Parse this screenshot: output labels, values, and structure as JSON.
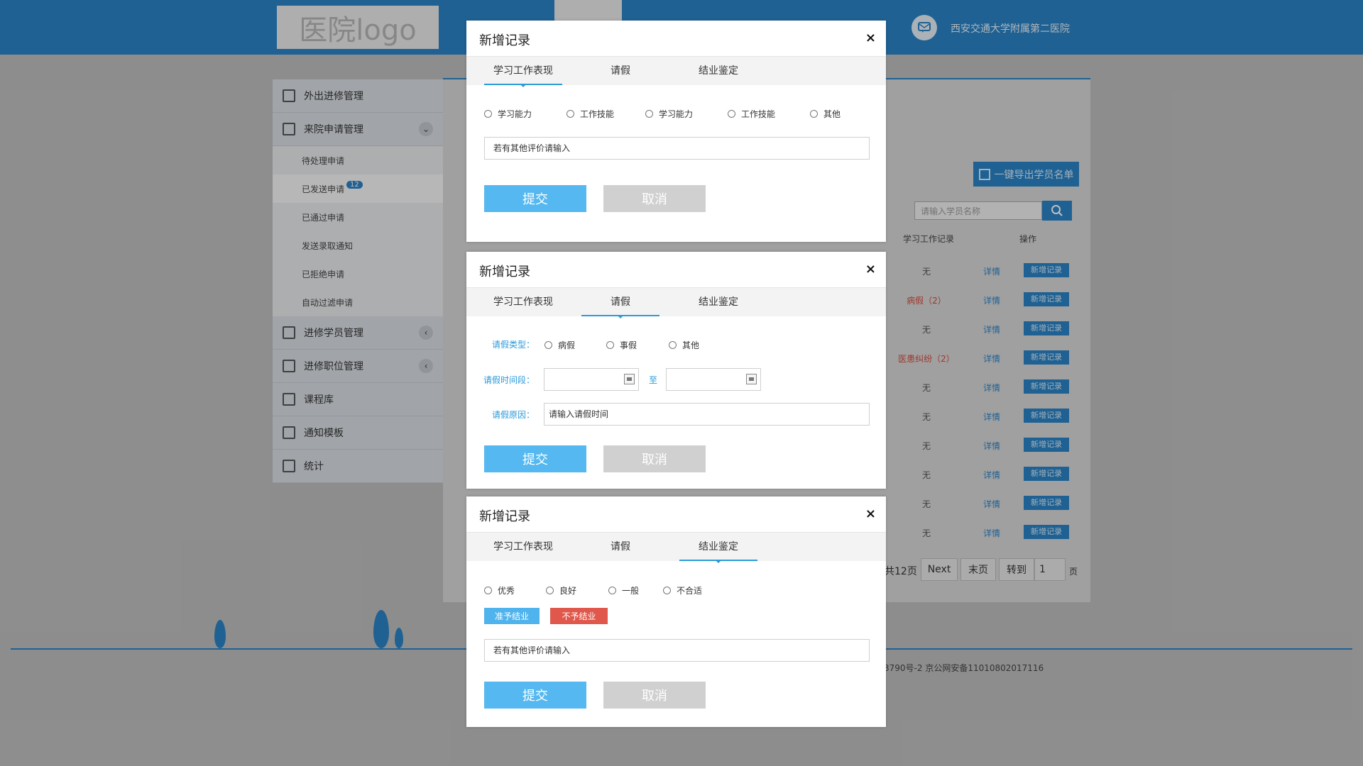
{
  "app": {
    "logo_text": "医院logo",
    "hospital_name": "西安交通大学附属第二医院"
  },
  "sidebar": {
    "items": [
      {
        "label": "外出进修管理",
        "icon": "clipboard-icon"
      },
      {
        "label": "来院申请管理",
        "icon": "form-icon",
        "expanded": true
      },
      {
        "label": "进修学员管理",
        "icon": "student-icon"
      },
      {
        "label": "进修职位管理",
        "icon": "position-icon"
      },
      {
        "label": "课程库",
        "icon": "course-icon"
      },
      {
        "label": "通知模板",
        "icon": "template-icon"
      },
      {
        "label": "统计",
        "icon": "bar-chart-icon"
      }
    ],
    "sub_items": [
      {
        "label": "待处理申请"
      },
      {
        "label": "已发送申请",
        "badge": "12"
      },
      {
        "label": "已通过申请"
      },
      {
        "label": "发送录取通知"
      },
      {
        "label": "已拒绝申请"
      },
      {
        "label": "自动过滤申请"
      }
    ]
  },
  "main": {
    "export_button": "一键导出学员名单",
    "search_placeholder": "请输入学员名称",
    "columns": [
      "学习工作记录",
      "操作"
    ],
    "rows": [
      {
        "record": "无",
        "detail": "详情",
        "add": "新增记录"
      },
      {
        "record": "病假（2）",
        "detail": "详情",
        "add": "新增记录"
      },
      {
        "record": "无",
        "detail": "详情",
        "add": "新增记录"
      },
      {
        "record": "医患纠纷（2）",
        "detail": "详情",
        "add": "新增记录"
      },
      {
        "record": "无",
        "detail": "详情",
        "add": "新增记录"
      },
      {
        "record": "无",
        "detail": "详情",
        "add": "新增记录"
      },
      {
        "record": "无",
        "detail": "详情",
        "add": "新增记录"
      },
      {
        "record": "无",
        "detail": "详情",
        "add": "新增记录"
      },
      {
        "record": "无",
        "detail": "详情",
        "add": "新增记录"
      },
      {
        "record": "无",
        "detail": "详情",
        "add": "新增记录"
      }
    ],
    "pager": {
      "total": "共12页",
      "next": "Next",
      "last": "末页",
      "goto": "转到",
      "page_value": "1",
      "page_unit": "页"
    },
    "footer_text": "3790号-2  京公网安备11010802017116"
  },
  "dialogs": [
    {
      "title": "新增记录",
      "close": "×",
      "tabs": [
        "学习工作表现",
        "请假",
        "结业鉴定"
      ],
      "active_tab": 0,
      "options": [
        "学习能力",
        "工作技能",
        "学习能力",
        "工作技能",
        "其他"
      ],
      "other_placeholder": "若有其他评价请输入",
      "submit": "提交",
      "cancel": "取消"
    },
    {
      "title": "新增记录",
      "close": "×",
      "tabs": [
        "学习工作表现",
        "请假",
        "结业鉴定"
      ],
      "active_tab": 1,
      "leave_type_label": "请假类型：",
      "leave_types": [
        "病假",
        "事假",
        "其他"
      ],
      "period_label": "请假时间段：",
      "to_label": "至",
      "reason_label": "请假原因：",
      "reason_placeholder": "请输入请假时间",
      "submit": "提交",
      "cancel": "取消"
    },
    {
      "title": "新增记录",
      "close": "×",
      "tabs": [
        "学习工作表现",
        "请假",
        "结业鉴定"
      ],
      "active_tab": 2,
      "grades": [
        "优秀",
        "良好",
        "一般",
        "不合适"
      ],
      "approve_label": "准予结业",
      "reject_label": "不予结业",
      "other_placeholder": "若有其他评价请输入",
      "submit": "提交",
      "cancel": "取消"
    }
  ],
  "colors": {
    "brand": "#2a82c4",
    "accent": "#2a9ad8",
    "submit": "#55b8f0",
    "danger": "#e0574b",
    "approve": "#4fb3ee"
  }
}
